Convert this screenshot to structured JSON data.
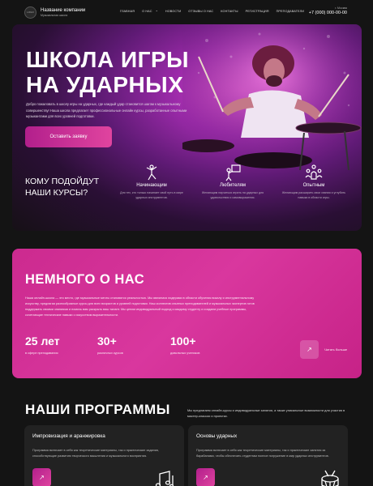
{
  "header": {
    "logo_text": "LOGO",
    "company_name": "Название компании",
    "company_sub": "Музыкальная школа",
    "nav": [
      "ГЛАВНАЯ",
      "О НАС",
      "⌄",
      "НОВОСТИ",
      "ОТЗЫВЫ О НАС",
      "КОНТАКТЫ",
      "РЕГИСТРАЦИЯ",
      "ПРЕПОДАВАТЕЛИ"
    ],
    "city": "г. Москва",
    "phone": "+7 (000) 000-00-00"
  },
  "hero": {
    "title_line1": "ШКОЛА ИГРЫ",
    "title_line2": "НА УДАРНЫХ",
    "description": "Добро пожаловать в школу игры на ударных, где каждый удар становится шагом к музыкальному совершенству! Наша школа предлагает профессиональные онлайн курсы, разработанные опытными музыкантами для всех уровней подготовки.",
    "cta": "Оставить заявку"
  },
  "audience": {
    "title_line1": "КОМУ ПОДОЙДУТ",
    "title_line2": "НАШИ КУРСЫ?",
    "items": [
      {
        "icon": "dancing-person-icon",
        "label": "Начинающим",
        "desc": "Для тех, кто только начинает свой путь в мире ударных инструментов."
      },
      {
        "icon": "presenter-icon",
        "label": "Любителям",
        "desc": "Желающим научиться играть на ударных для удовольствия и самовыражения."
      },
      {
        "icon": "group-icon",
        "label": "Опытным",
        "desc": "Желающим расширить свои знания и углубить навыки в области игры."
      }
    ]
  },
  "about": {
    "title": "НЕМНОГО О НАС",
    "text": "Наша онлайн-школа — это место, где музыкальные мечты становятся реальностью. Мы являемся лидерами в области обучения вокалу и инструментальному искусству, предлагая разнообразные курсы для всех возрастов и уровней подготовки. Наш коллектив опытных преподавателей и музыкальных экспертов готов поддержать своими знаниями и помочь вам раскрыть ваш талант. Мы ценим индивидуальный подход к каждому студенту и создаем учебные программы, сочетающие технические навыки с искусством выразительности.",
    "stats": [
      {
        "value": "25 лет",
        "label": "в сфере преподавания"
      },
      {
        "value": "30+",
        "label": "различных курсов"
      },
      {
        "value": "100+",
        "label": "довольных учеников"
      }
    ],
    "more_arrow": "↗",
    "more_label": "Читать больше"
  },
  "programs": {
    "title": "НАШИ ПРОГРАММЫ",
    "desc": "Мы предлагаем онлайн-курсы и индивидуальные занятия, а также уникальные возможности для участия в мастер-классах и проектах.",
    "cards": [
      {
        "title": "Импровизация и аранжировка",
        "text": "Программа включает в себя как теоретические материалы, так и практические задания, способствующие развитию творческого мышления и музыкального восприятия.",
        "arrow": "↗",
        "icon": "music-notes-icon"
      },
      {
        "title": "Основы ударных",
        "text": "Программа включает в себя как теоретические материалы, так и практические занятия за барабанами, чтобы обеспечить студентам полное погружение в мир ударных инструментов.",
        "arrow": "↗",
        "icon": "drum-icon"
      }
    ]
  },
  "colors": {
    "accent": "#d9379e",
    "background": "#141414",
    "card": "#222222"
  }
}
